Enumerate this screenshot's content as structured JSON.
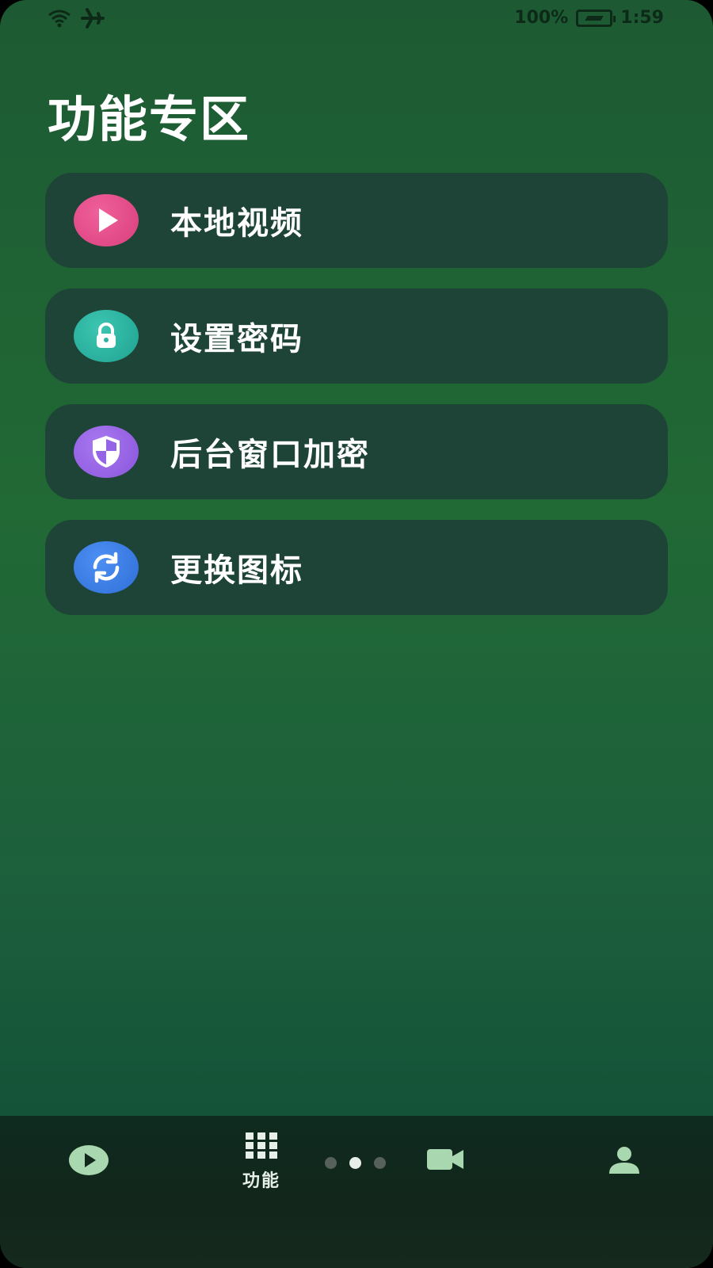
{
  "status_bar": {
    "battery_percent": "100%",
    "time": "1:59",
    "icons": [
      "wifi-icon",
      "airplane-icon",
      "battery-charging-icon"
    ]
  },
  "page": {
    "title": "功能专区"
  },
  "menu": {
    "items": [
      {
        "label": "本地视频",
        "icon": "play-icon",
        "color": "#e14a87"
      },
      {
        "label": "设置密码",
        "icon": "lock-icon",
        "color": "#2db4a2"
      },
      {
        "label": "后台窗口加密",
        "icon": "shield-icon",
        "color": "#9463e6"
      },
      {
        "label": "更换图标",
        "icon": "refresh-icon",
        "color": "#3a7ee6"
      }
    ]
  },
  "bottom_nav": {
    "items": [
      {
        "icon": "play-circle-icon",
        "label": ""
      },
      {
        "icon": "grid-icon",
        "label": "功能"
      },
      {
        "icon": "video-camera-icon",
        "label": ""
      },
      {
        "icon": "person-icon",
        "label": ""
      }
    ],
    "active_index": 1,
    "page_indicator": {
      "count": 3,
      "active": 1
    }
  },
  "colors": {
    "accent_green": "#a9d7b0",
    "card_bg": "#1e4437"
  }
}
